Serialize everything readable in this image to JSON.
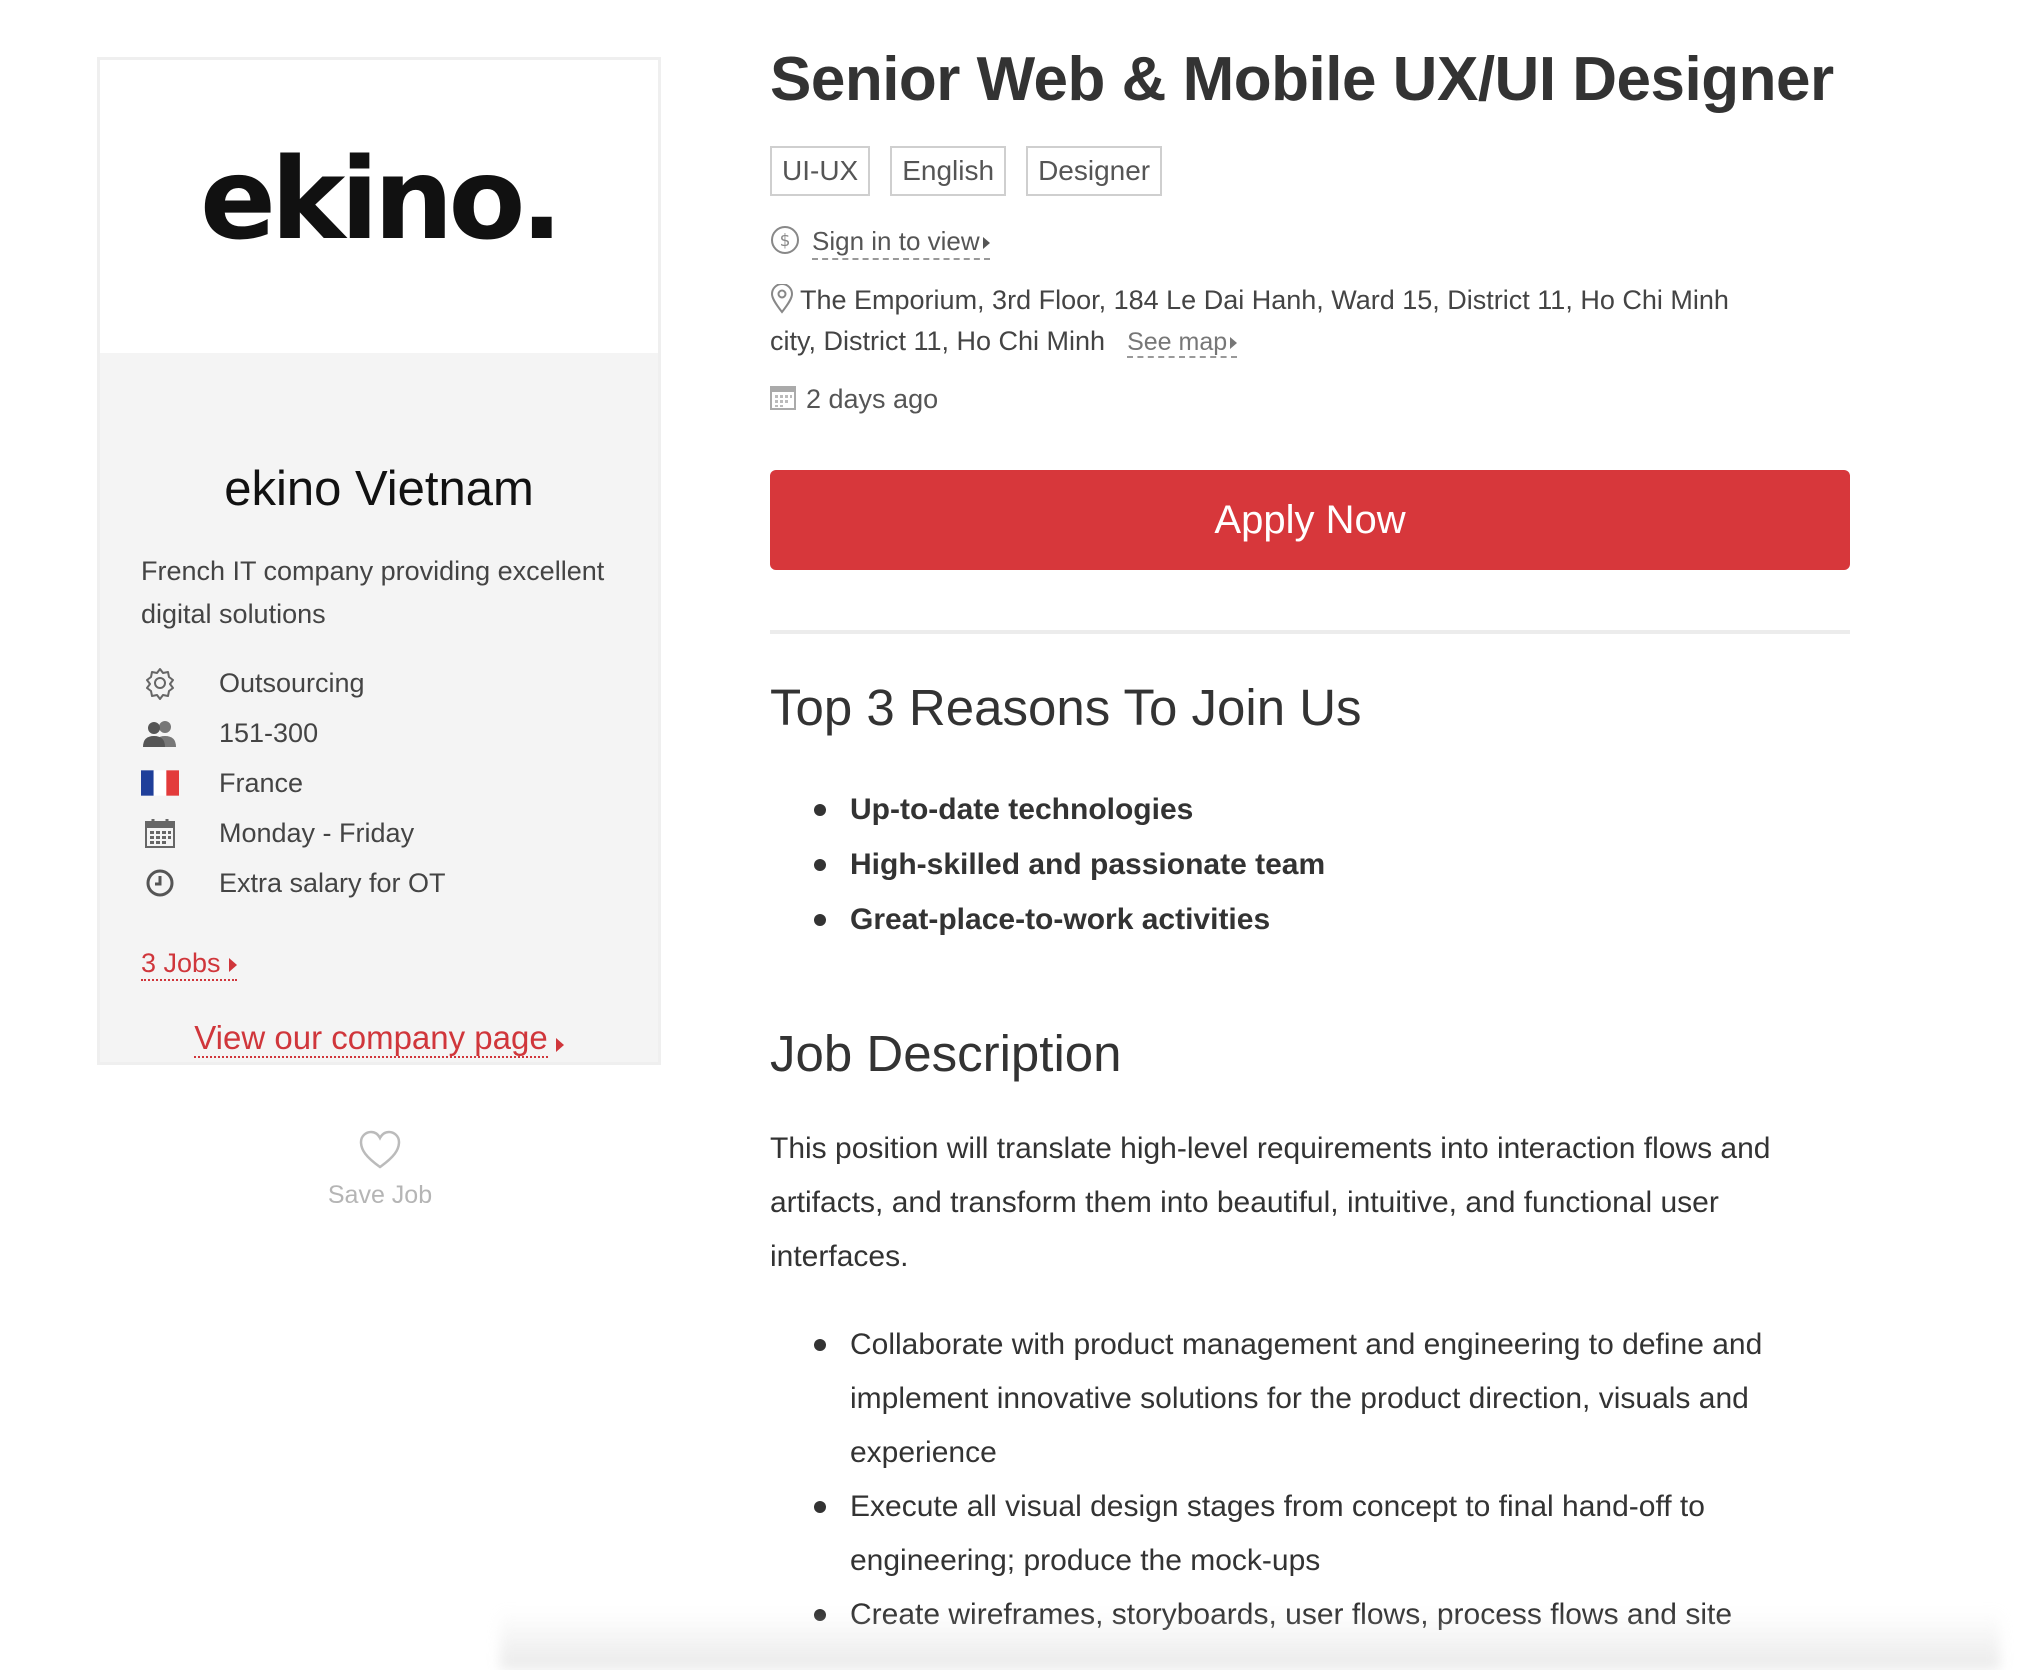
{
  "company": {
    "logo_text": "ekino.",
    "name": "ekino Vietnam",
    "tagline": "French IT company providing excellent digital solutions",
    "info": [
      {
        "icon": "gear-icon",
        "text": "Outsourcing"
      },
      {
        "icon": "people-icon",
        "text": "151-300"
      },
      {
        "icon": "france-flag-icon",
        "text": "France"
      },
      {
        "icon": "calendar-icon",
        "text": "Monday - Friday"
      },
      {
        "icon": "clock-icon",
        "text": "Extra salary for OT"
      }
    ],
    "jobs_link": "3 Jobs",
    "company_page_link": "View our company page",
    "save_job": "Save Job",
    "colors": {
      "link": "#d0363b",
      "flag_blue": "#1f3f9a",
      "flag_red": "#e33b3b"
    }
  },
  "job": {
    "title": "Senior Web & Mobile UX/UI Designer",
    "tags": [
      "UI-UX",
      "English",
      "Designer"
    ],
    "salary_link": "Sign in to view",
    "address": "The Emporium, 3rd Floor, 184 Le Dai Hanh, Ward 15, District 11, Ho Chi Minh city, District 11, Ho Chi Minh",
    "see_map": "See map",
    "posted": "2 days ago",
    "apply_label": "Apply Now",
    "apply_color": "#d7373b"
  },
  "reasons": {
    "title": "Top 3 Reasons To Join Us",
    "items": [
      "Up-to-date technologies",
      "High-skilled and passionate team",
      "Great-place-to-work activities"
    ]
  },
  "description": {
    "title": "Job Description",
    "paragraph": "This position will translate high-level requirements into interaction flows and artifacts, and transform them into beautiful, intuitive, and functional user interfaces.",
    "items": [
      "Collaborate with product management and engineering to define and implement innovative solutions for the product direction, visuals and experience",
      "Execute all visual design stages from concept to final hand-off to engineering; produce the mock-ups",
      "Create wireframes, storyboards, user flows, process flows and site"
    ]
  }
}
